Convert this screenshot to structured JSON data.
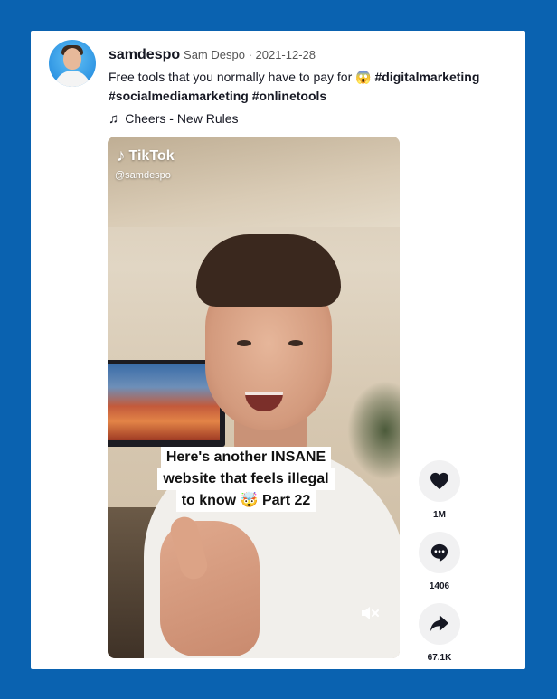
{
  "post": {
    "username": "samdespo",
    "display_name": "Sam Despo",
    "date_separator": " · ",
    "date": "2021-12-28",
    "caption_text": "Free tools that you normally have to pay for ",
    "emoji": "😱",
    "hashtags": [
      "#digitalmarketing",
      "#socialmediamarketing",
      "#onlinetools"
    ],
    "music": "Cheers - New Rules"
  },
  "video": {
    "watermark": "TikTok",
    "watermark_handle": "@samdespo",
    "overlay_lines": [
      "Here's another INSANE",
      "website that feels illegal",
      "to know 🤯 Part 22"
    ]
  },
  "actions": {
    "likes": "1M",
    "comments": "1406",
    "shares": "67.1K"
  },
  "icons": [
    "music-note-icon",
    "tiktok-logo-icon",
    "mute-icon",
    "heart-icon",
    "comment-icon",
    "share-icon"
  ],
  "colors": {
    "frame": "#0a62b0",
    "card": "#ffffff",
    "action_bg": "#f1f1f2",
    "text": "#161823"
  }
}
